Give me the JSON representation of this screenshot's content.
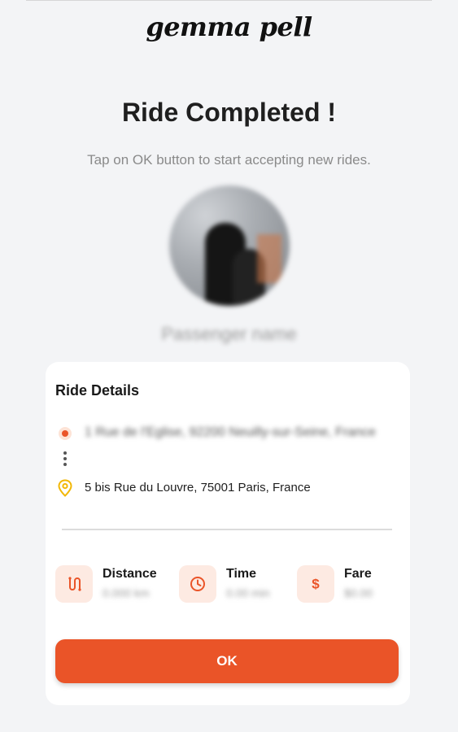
{
  "brand": {
    "name": "gemma pell"
  },
  "header": {
    "title": "Ride Completed !",
    "subtitle": "Tap on OK button to start accepting new rides."
  },
  "passenger": {
    "name": "Passenger name"
  },
  "ride_details": {
    "title": "Ride Details",
    "pickup": "1 Rue de l'Eglise, 92200 Neuilly-sur-Seine, France",
    "dropoff": "5 bis Rue du Louvre, 75001 Paris, France",
    "stats": [
      {
        "label": "Distance",
        "value": "0.000 km",
        "icon": "route-icon"
      },
      {
        "label": "Time",
        "value": "0.00 min",
        "icon": "clock-icon"
      },
      {
        "label": "Fare",
        "value": "$0.00",
        "icon": "dollar-icon"
      }
    ]
  },
  "actions": {
    "ok_label": "OK"
  },
  "colors": {
    "accent": "#ea5428",
    "accent_soft": "#fdeae2",
    "pin": "#f2b705",
    "background": "#f3f4f6"
  }
}
